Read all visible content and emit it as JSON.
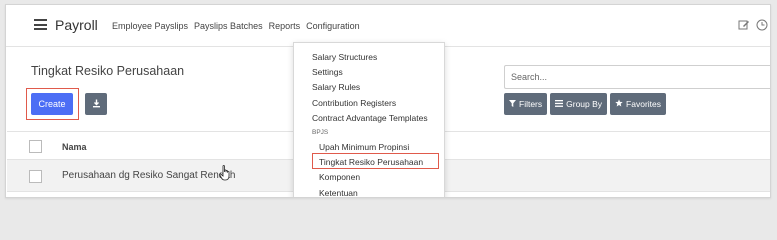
{
  "navbar": {
    "app_title": "Payroll",
    "menu": [
      "Employee Payslips",
      "Payslips Batches",
      "Reports",
      "Configuration"
    ],
    "icons": [
      "edit-icon",
      "clock-icon"
    ]
  },
  "control_panel": {
    "page_title": "Tingkat Resiko Perusahaan",
    "create_label": "Create",
    "search_placeholder": "Search...",
    "filters_label": "Filters",
    "group_by_label": "Group By",
    "favorites_label": "Favorites"
  },
  "list": {
    "column_header": "Nama",
    "rows": [
      "Perusahaan dg Resiko Sangat Rendah"
    ]
  },
  "configuration_menu": {
    "items": [
      "Salary Structures",
      "Settings",
      "Salary Rules",
      "Contribution Registers",
      "Contract Advantage Templates"
    ],
    "section_header": "BPJS",
    "sub_items": [
      "Upah Minimum Propinsi",
      "Tingkat Resiko Perusahaan",
      "Komponen",
      "Ketentuan"
    ]
  },
  "colors": {
    "primary": "#4c6ef5",
    "secondary": "#5f6b7a",
    "highlight": "#e05a4b"
  }
}
